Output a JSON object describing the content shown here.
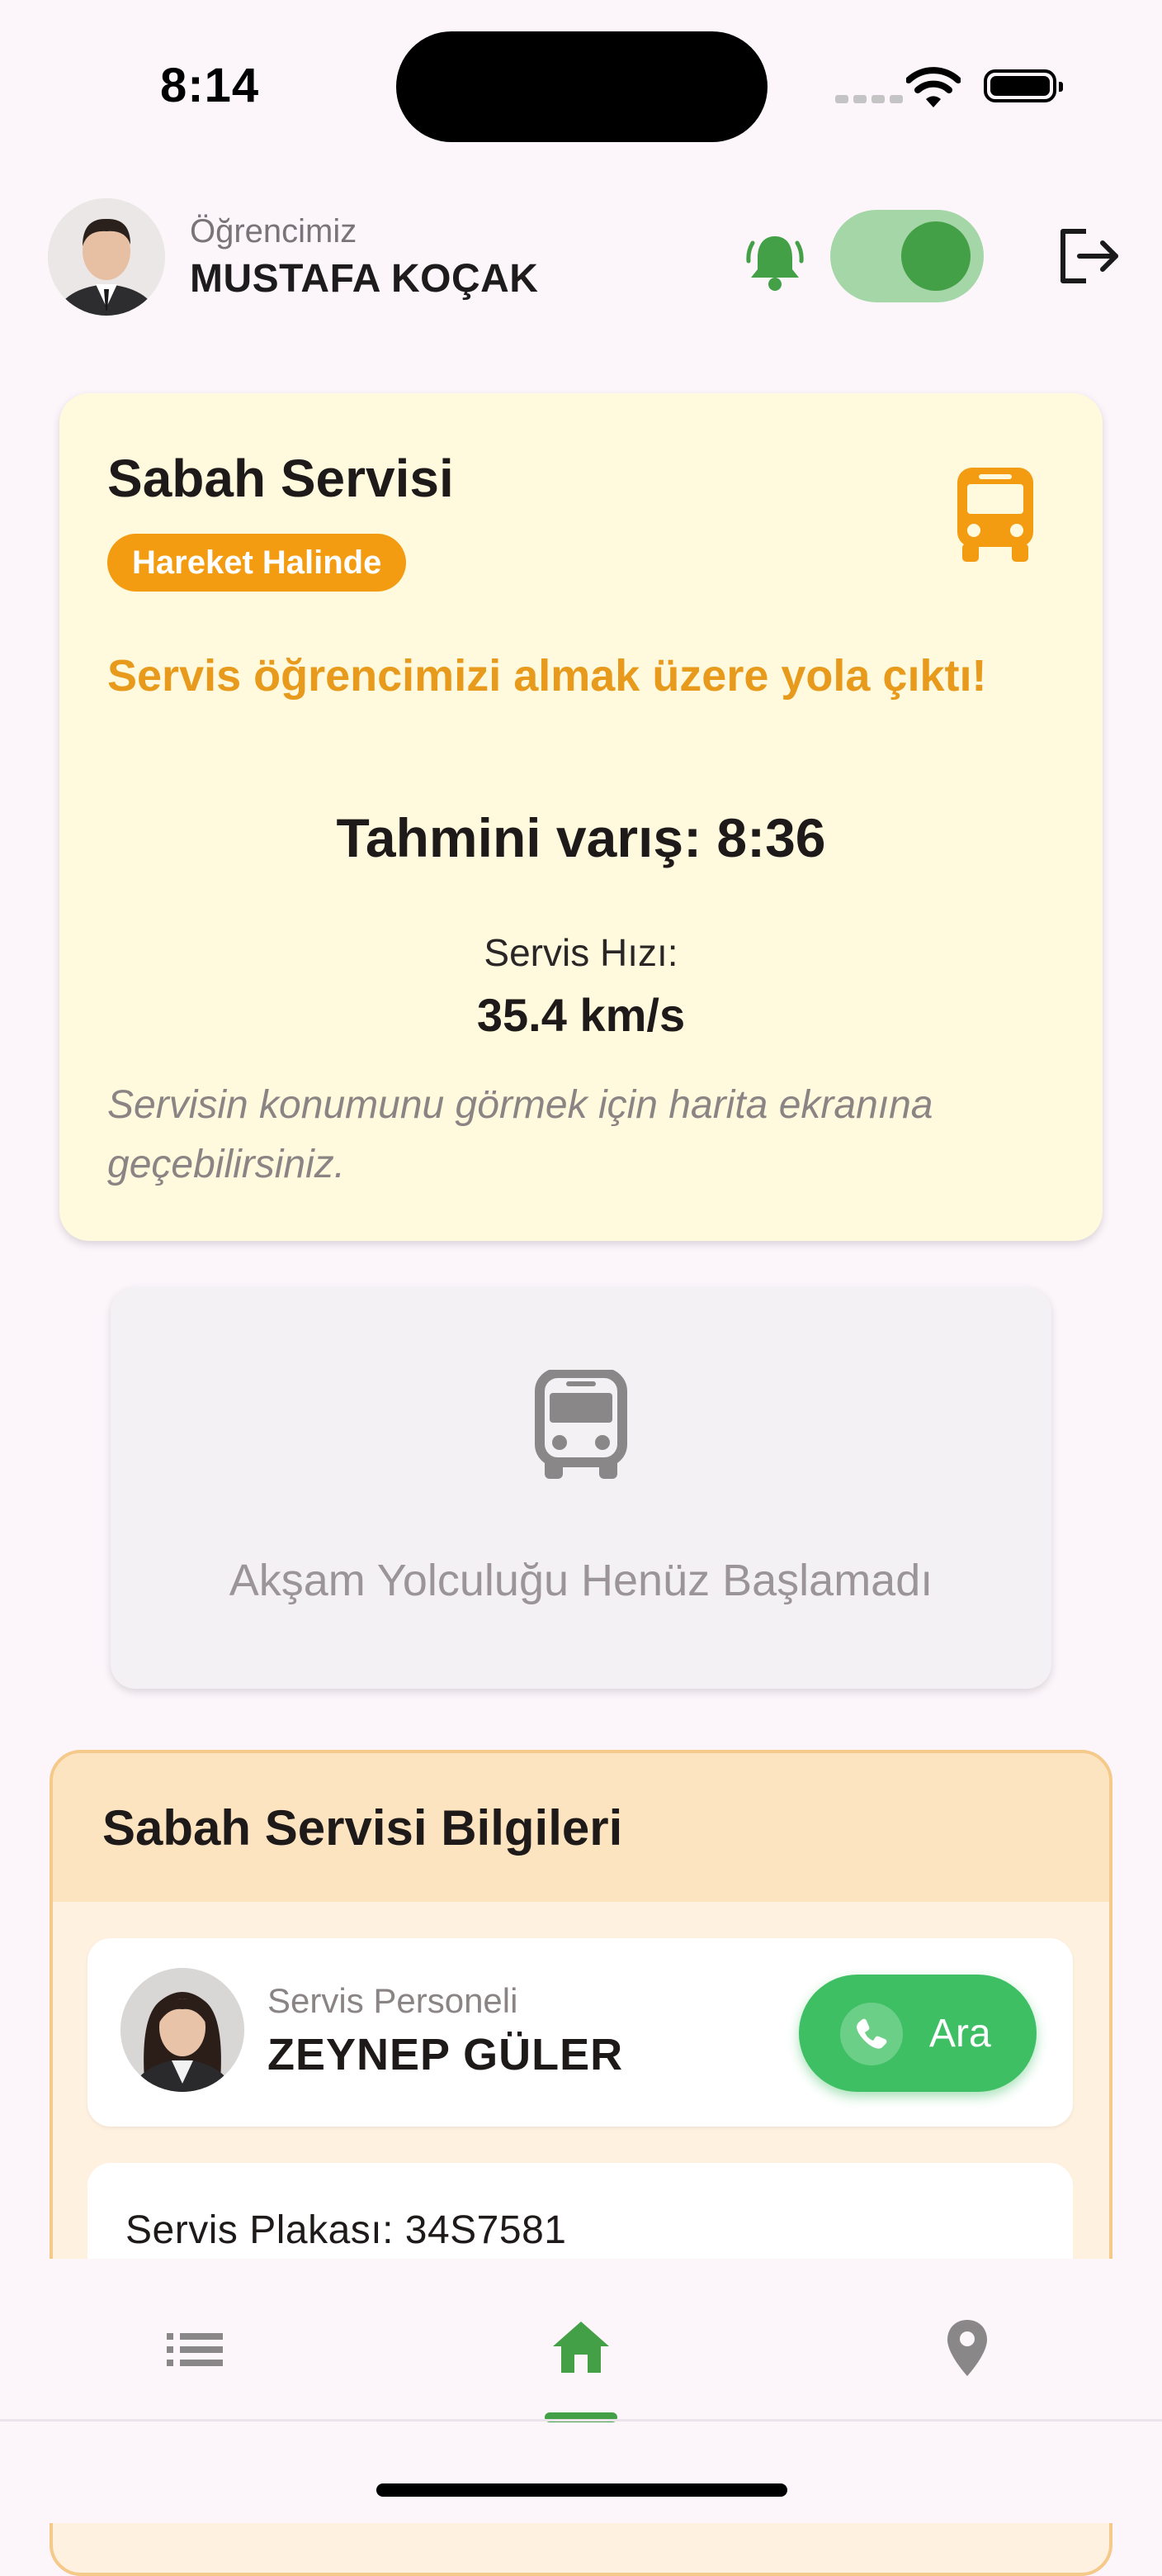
{
  "status_bar": {
    "time": "8:14"
  },
  "header": {
    "caption": "Öğrencimiz",
    "student_name": "MUSTAFA KOÇAK",
    "notifications_enabled": true
  },
  "morning_card": {
    "title": "Sabah Servisi",
    "status_badge": "Hareket Halinde",
    "message": "Servis öğrencimizi almak üzere yola çıktı!",
    "eta": "Tahmini varış: 8:36",
    "speed_label": "Servis Hızı:",
    "speed_value": "35.4 km/s",
    "hint": "Servisin konumunu görmek için harita ekranına geçebilirsiniz."
  },
  "evening_card": {
    "text": "Akşam Yolculuğu Henüz Başlamadı"
  },
  "info_panel": {
    "title": "Sabah Servisi Bilgileri",
    "staff_caption": "Servis Personeli",
    "staff_name": "ZEYNEP GÜLER",
    "call_label": "Ara",
    "plate": "Servis Plakası: 34S7581"
  },
  "bottom_nav": {
    "items": [
      "list-icon",
      "home-icon",
      "location-pin-icon"
    ],
    "active": "home-icon"
  },
  "colors": {
    "accent_green": "#43a047",
    "status_orange": "#f39c12",
    "message_orange": "#e79a1b",
    "morning_card_bg": "#fff9dd",
    "info_panel_border": "#f5c98a",
    "call_button": "#3fbf64"
  }
}
